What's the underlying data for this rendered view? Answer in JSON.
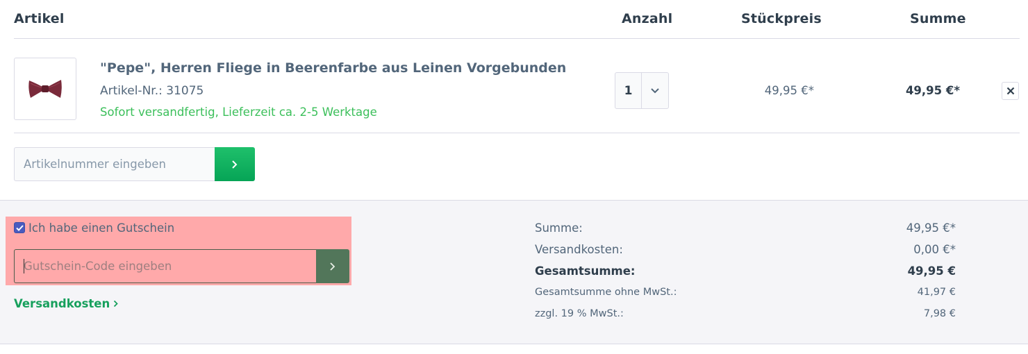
{
  "table_header": {
    "artikel": "Artikel",
    "anzahl": "Anzahl",
    "stueckpreis": "Stückpreis",
    "summe": "Summe"
  },
  "item": {
    "name": "\"Pepe\", Herren Fliege in Beerenfarbe aus Leinen Vorgebunden",
    "article_number": "Artikel-Nr.: 31075",
    "delivery": "Sofort versandfertig, Lieferzeit ca. 2-5 Werktage",
    "quantity": "1",
    "unit_price": "49,95 €*",
    "total_price": "49,95 €*",
    "image_icon": "bow-tie-icon",
    "remove_icon": "close-icon"
  },
  "add_article": {
    "placeholder": "Artikelnummer eingeben",
    "button_icon": "chevron-right-icon"
  },
  "voucher": {
    "checkbox_label": "Ich habe einen Gutschein",
    "checked": true,
    "placeholder": "Gutschein-Code eingeben",
    "button_icon": "chevron-right-icon"
  },
  "shipping_link": {
    "label": "Versandkosten",
    "icon": "chevron-right-icon"
  },
  "summary": {
    "summe_label": "Summe:",
    "summe_value": "49,95 €*",
    "versand_label": "Versandkosten:",
    "versand_value": "0,00 €*",
    "gesamt_label": "Gesamtsumme:",
    "gesamt_value": "49,95 €",
    "netto_label": "Gesamtsumme ohne MwSt.:",
    "netto_value": "41,97 €",
    "mwst_label": "zzgl. 19 % MwSt.:",
    "mwst_value": "7,98 €"
  },
  "colors": {
    "accent_green": "#17a05d",
    "delivery_green": "#3bbf5a",
    "highlight": "#ffa9aa",
    "text": "#52667a"
  }
}
